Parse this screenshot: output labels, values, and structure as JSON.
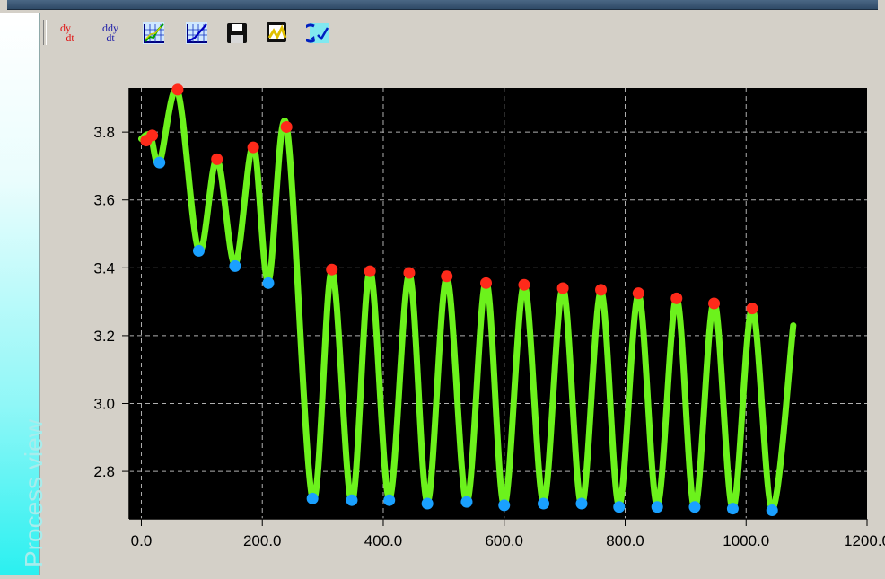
{
  "sidebar": {
    "label": "Process view"
  },
  "toolbar": {
    "buttons": [
      {
        "name": "first-derivative-button",
        "icon": "dy-dt-icon",
        "num": "dy",
        "den": "dt",
        "color": "#e01010"
      },
      {
        "name": "second-derivative-button",
        "icon": "ddy-dt-icon",
        "num": "ddy",
        "den": "dt",
        "color": "#1a1aa8"
      },
      {
        "name": "multi-curve-plot-button",
        "icon": "multi-curve-chart-icon"
      },
      {
        "name": "single-curve-plot-button",
        "icon": "line-chart-icon"
      },
      {
        "name": "save-button",
        "icon": "floppy-disk-icon"
      },
      {
        "name": "save-plot-button",
        "icon": "save-chart-icon"
      },
      {
        "name": "refresh-button",
        "icon": "refresh-chart-icon"
      }
    ]
  },
  "chart_data": {
    "type": "line",
    "x_tick_labels": [
      "0.0",
      "200.0",
      "400.0",
      "600.0",
      "800.0",
      "1000.0",
      "1200.0"
    ],
    "y_tick_labels": [
      "2.8",
      "3.0",
      "3.2",
      "3.4",
      "3.6",
      "3.8"
    ],
    "xlim": [
      -20,
      1200
    ],
    "ylim": [
      2.66,
      3.93
    ],
    "grid": true,
    "line_color": "#6cf21c",
    "max_marker_color": "#ff2a1a",
    "min_marker_color": "#1aa0ff",
    "plot_background": "#000000",
    "series": [
      {
        "x": [
          0,
          15,
          30,
          60,
          95,
          125,
          155,
          185,
          210,
          240,
          283,
          315,
          348,
          378,
          410,
          443,
          473,
          505,
          538,
          570,
          600,
          633,
          665,
          697,
          728,
          760,
          790,
          822,
          853,
          885,
          915,
          947,
          978,
          1010,
          1043,
          1078
        ],
        "y": [
          3.78,
          3.79,
          3.71,
          3.92,
          3.45,
          3.72,
          3.41,
          3.76,
          3.36,
          3.82,
          2.72,
          3.39,
          2.71,
          3.39,
          2.72,
          3.38,
          2.71,
          3.37,
          2.71,
          3.36,
          2.7,
          3.35,
          2.71,
          3.34,
          2.7,
          3.33,
          2.7,
          3.32,
          2.7,
          3.31,
          2.69,
          3.3,
          2.69,
          3.28,
          2.69,
          3.23
        ]
      }
    ],
    "maxima": {
      "x": [
        8,
        18,
        60,
        125,
        185,
        240,
        315,
        378,
        443,
        505,
        570,
        633,
        697,
        760,
        822,
        885,
        947,
        1010
      ],
      "y": [
        3.775,
        3.79,
        3.925,
        3.72,
        3.755,
        3.815,
        3.395,
        3.39,
        3.385,
        3.375,
        3.355,
        3.35,
        3.34,
        3.335,
        3.325,
        3.31,
        3.295,
        3.28
      ]
    },
    "minima": {
      "x": [
        30,
        95,
        155,
        210,
        283,
        348,
        410,
        473,
        538,
        600,
        665,
        728,
        790,
        853,
        915,
        978,
        1043
      ],
      "y": [
        3.71,
        3.45,
        3.405,
        3.355,
        2.72,
        2.715,
        2.715,
        2.705,
        2.71,
        2.7,
        2.705,
        2.705,
        2.695,
        2.695,
        2.695,
        2.69,
        2.685
      ]
    }
  }
}
